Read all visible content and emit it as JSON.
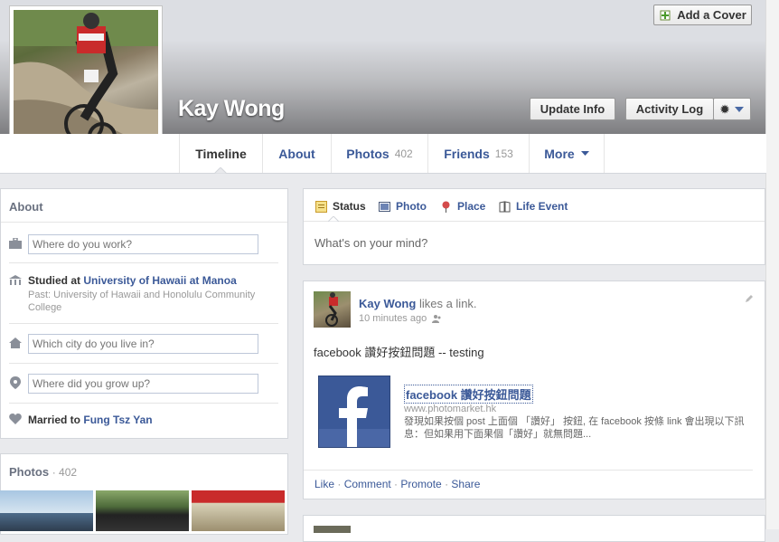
{
  "header": {
    "add_cover_label": "Add a Cover",
    "name": "Kay Wong",
    "update_info_label": "Update Info",
    "activity_log_label": "Activity Log"
  },
  "tabs": [
    {
      "label": "Timeline"
    },
    {
      "label": "About"
    },
    {
      "label": "Photos",
      "count": "402"
    },
    {
      "label": "Friends",
      "count": "153"
    },
    {
      "label": "More"
    }
  ],
  "about": {
    "title": "About",
    "work_placeholder": "Where do you work?",
    "studied_prefix": "Studied at",
    "studied_school": "University of Hawaii at Manoa",
    "past_text": "Past: University of Hawaii and Honolulu Community College",
    "city_placeholder": "Which city do you live in?",
    "grew_placeholder": "Where did you grow up?",
    "married_prefix": "Married to",
    "married_name": "Fung Tsz Yan"
  },
  "photos_section": {
    "title": "Photos",
    "count": "· 402"
  },
  "composer": {
    "tabs": [
      "Status",
      "Photo",
      "Place",
      "Life Event"
    ],
    "placeholder": "What's on your mind?"
  },
  "post": {
    "author": "Kay Wong",
    "action": "likes a link.",
    "time": "10 minutes ago",
    "text": "facebook 讚好按鈕問題 -- testing",
    "link_title": "facebook 讚好按鈕問題",
    "link_domain": "www.photomarket.hk",
    "link_desc": "發現如果按個 post 上面個 「讚好」 按鈕, 在 facebook 按條 link 會出現以下訊息：但如果用下面果個「讚好」就無問題...",
    "actions": [
      "Like",
      "Comment",
      "Promote",
      "Share"
    ]
  }
}
